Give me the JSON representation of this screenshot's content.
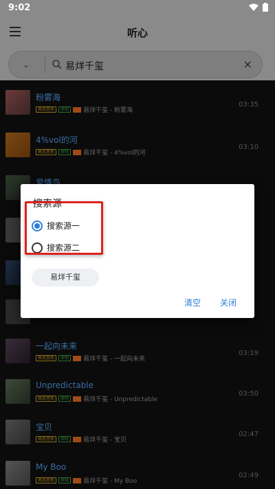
{
  "status_bar": {
    "time": "9:02"
  },
  "app_bar": {
    "title": "听心"
  },
  "search": {
    "value": "易烊千玺"
  },
  "songs": [
    {
      "title": "粉雾海",
      "subtitle": "易烊千玺 - 粉雾海",
      "duration": "03:35",
      "tag1": "高品音质",
      "tag2": "原唱"
    },
    {
      "title": "4%vol的河",
      "subtitle": "易烊千玺 - 4%vol的河",
      "duration": "03:10",
      "tag1": "高品音质",
      "tag2": "原唱"
    },
    {
      "title": "爱情鸟",
      "subtitle": "",
      "duration": "",
      "tag1": "",
      "tag2": ""
    },
    {
      "title": "",
      "subtitle": "",
      "duration": "",
      "tag1": "",
      "tag2": ""
    },
    {
      "title": "",
      "subtitle": "",
      "duration": "",
      "tag1": "",
      "tag2": ""
    },
    {
      "title": "",
      "subtitle": "",
      "duration": "",
      "tag1": "",
      "tag2": ""
    },
    {
      "title": "一起向未来",
      "subtitle": "易烊千玺 - 一起向未来",
      "duration": "03:19",
      "tag1": "高品音质",
      "tag2": "原唱"
    },
    {
      "title": "Unpredictable",
      "subtitle": "易烊千玺 - Unpredictable",
      "duration": "03:50",
      "tag1": "高品音质",
      "tag2": "原唱"
    },
    {
      "title": "宝贝",
      "subtitle": "易烊千玺 - 宝贝",
      "duration": "02:47",
      "tag1": "高品音质",
      "tag2": "原唱"
    },
    {
      "title": "My Boo",
      "subtitle": "易烊千玺 - My Boo",
      "duration": "02:49",
      "tag1": "高品音质",
      "tag2": "原唱"
    }
  ],
  "dialog": {
    "title": "搜索源",
    "option1": "搜索源一",
    "option2": "搜索源二",
    "history_chip": "易烊千玺",
    "clear_label": "清空",
    "close_label": "关闭"
  },
  "colors": {
    "accent": "#2f7fd8",
    "highlight": "#e02020",
    "title_blue": "#3a6ea5"
  }
}
